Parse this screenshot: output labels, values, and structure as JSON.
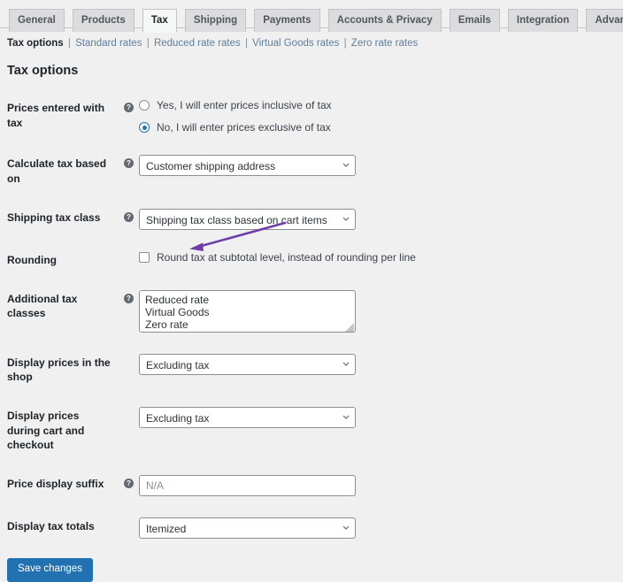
{
  "tabs": [
    {
      "label": "General",
      "active": false
    },
    {
      "label": "Products",
      "active": false
    },
    {
      "label": "Tax",
      "active": true
    },
    {
      "label": "Shipping",
      "active": false
    },
    {
      "label": "Payments",
      "active": false
    },
    {
      "label": "Accounts & Privacy",
      "active": false
    },
    {
      "label": "Emails",
      "active": false
    },
    {
      "label": "Integration",
      "active": false
    },
    {
      "label": "Advanced",
      "active": false
    }
  ],
  "subnav": {
    "current": "Tax options",
    "separator": "|",
    "links": [
      "Standard rates",
      "Reduced rate rates",
      "Virtual Goods rates",
      "Zero rate rates"
    ]
  },
  "section": {
    "title": "Tax options"
  },
  "help_icon_glyph": "?",
  "fields": {
    "prices_entered_with_tax": {
      "label": "Prices entered with tax",
      "options": [
        {
          "label": "Yes, I will enter prices inclusive of tax",
          "selected": false
        },
        {
          "label": "No, I will enter prices exclusive of tax",
          "selected": true
        }
      ]
    },
    "calculate_tax_based_on": {
      "label": "Calculate tax based on",
      "value": "Customer shipping address"
    },
    "shipping_tax_class": {
      "label": "Shipping tax class",
      "value": "Shipping tax class based on cart items"
    },
    "rounding": {
      "label": "Rounding",
      "checkbox_label": "Round tax at subtotal level, instead of rounding per line",
      "checked": false
    },
    "additional_tax_classes": {
      "label": "Additional tax classes",
      "value": "Reduced rate\nVirtual Goods\nZero rate"
    },
    "display_prices_in_the_shop": {
      "label": "Display prices in the shop",
      "value": "Excluding tax"
    },
    "display_prices_during_cart_and_checkout": {
      "label": "Display prices during cart and checkout",
      "value": "Excluding tax"
    },
    "price_display_suffix": {
      "label": "Price display suffix",
      "value": "",
      "placeholder": "N/A"
    },
    "display_tax_totals": {
      "label": "Display tax totals",
      "value": "Itemized"
    }
  },
  "submit": {
    "label": "Save changes"
  },
  "annotation": {
    "color": "#6f3fa8",
    "target_text": "Virtual Goods"
  },
  "colors": {
    "page_background": "#f0f0f1",
    "accent_blue": "#2271b1",
    "link_blue": "#5f7f9c",
    "border_gray": "#8c8f94",
    "annotation_purple": "#6f3fa8"
  }
}
